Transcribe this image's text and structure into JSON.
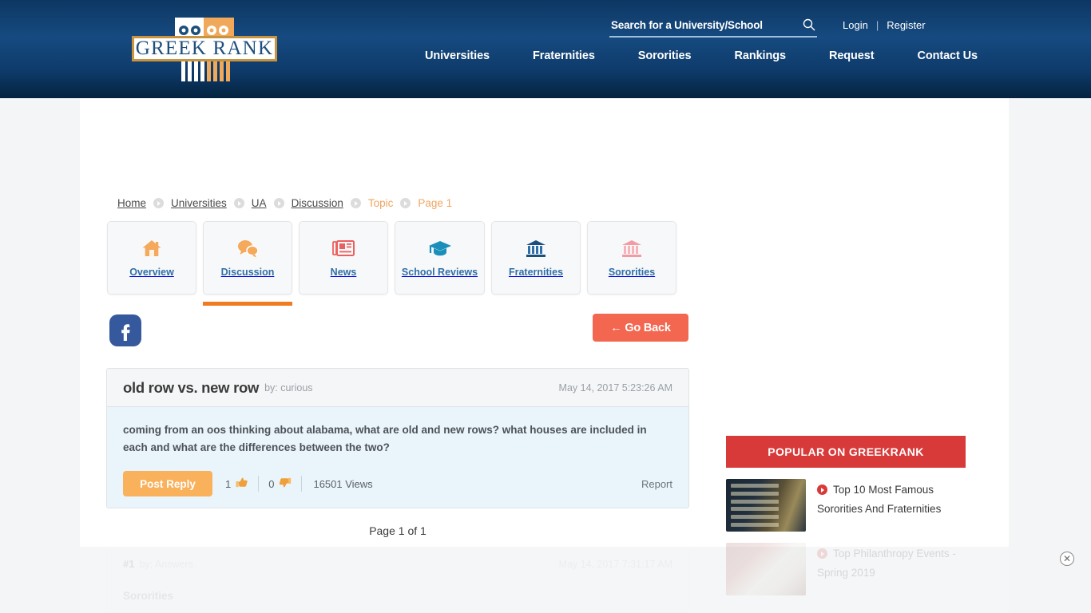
{
  "site": {
    "logo_text_1": "GREEK",
    "logo_text_2": "RANK"
  },
  "header": {
    "search": {
      "placeholder": "Search for a University/School",
      "value": ""
    },
    "login_label": "Login",
    "separator": "|",
    "register_label": "Register",
    "nav": [
      {
        "label": "Universities"
      },
      {
        "label": "Fraternities"
      },
      {
        "label": "Sororities"
      },
      {
        "label": "Rankings"
      },
      {
        "label": "Request"
      },
      {
        "label": "Contact Us"
      }
    ]
  },
  "breadcrumb": [
    {
      "label": "Home",
      "state": "muted"
    },
    {
      "label": "Universities",
      "state": "muted"
    },
    {
      "label": "UA",
      "state": "muted"
    },
    {
      "label": "Discussion",
      "state": "muted"
    },
    {
      "label": "Topic",
      "state": "active"
    },
    {
      "label": "Page 1",
      "state": "active"
    }
  ],
  "tabs": [
    {
      "label": "Overview",
      "icon": "home-icon",
      "active": false
    },
    {
      "label": "Discussion",
      "icon": "chat-bubbles-icon",
      "active": true
    },
    {
      "label": "News",
      "icon": "newspaper-icon",
      "active": false
    },
    {
      "label": "School Reviews",
      "icon": "graduation-cap-icon",
      "active": false
    },
    {
      "label": "Fraternities",
      "icon": "bank-columns-icon",
      "active": false
    },
    {
      "label": "Sororities",
      "icon": "bank-columns-pink-icon",
      "active": false
    }
  ],
  "toolbar": {
    "facebook_icon": "facebook-icon",
    "go_back_label": "← Go Back"
  },
  "post": {
    "title": "old row vs. new row",
    "author": "by: curious",
    "date": "May 14, 2017 5:23:26 AM",
    "text": "coming from an oos thinking about alabama, what are old and new rows? what houses are included in each and what are the differences between the two?",
    "reply_button_label": "Post Reply",
    "upvotes": "1",
    "downvotes": "0",
    "views": "16501 Views",
    "report_label": "Report"
  },
  "pagination": {
    "label": "Page 1 of 1"
  },
  "reply": {
    "number": "#1",
    "author": "by: Answers",
    "date": "May 14, 2017 7:31:17 AM",
    "text": "Sororities"
  },
  "sidebar": {
    "heading": "POPULAR ON GREEKRANK",
    "items": [
      {
        "title": "Top 10 Most Famous Sororities And Fraternities",
        "faded": false
      },
      {
        "title": "Top Philanthropy Events - Spring 2019",
        "faded": true
      }
    ]
  },
  "ad": {
    "close_label": "✕"
  },
  "colors": {
    "header_blue": "#0e3b6b",
    "accent_orange": "#f07c1f",
    "button_orange": "#f9b15c",
    "go_back_red": "#f3664f",
    "popular_red": "#d83a3a",
    "link_blue": "#2f6fa7"
  }
}
